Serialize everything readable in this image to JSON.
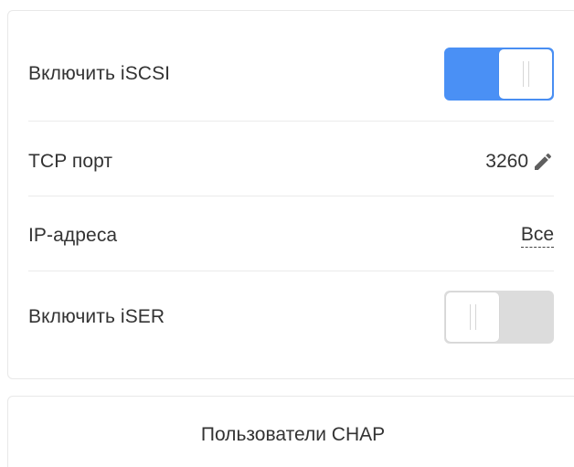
{
  "settings": {
    "iscsi": {
      "label": "Включить iSCSI",
      "enabled": true
    },
    "tcp_port": {
      "label": "TCP порт",
      "value": "3260",
      "edit_icon": "pencil-icon"
    },
    "ip_addresses": {
      "label": "IP-адреса",
      "value": "Все"
    },
    "iser": {
      "label": "Включить iSER",
      "enabled": false
    }
  },
  "chap": {
    "label": "Пользователи CHAP"
  },
  "colors": {
    "accent": "#4a90f5",
    "toggle_off": "#dcdcdc",
    "divider": "#ebebeb"
  }
}
